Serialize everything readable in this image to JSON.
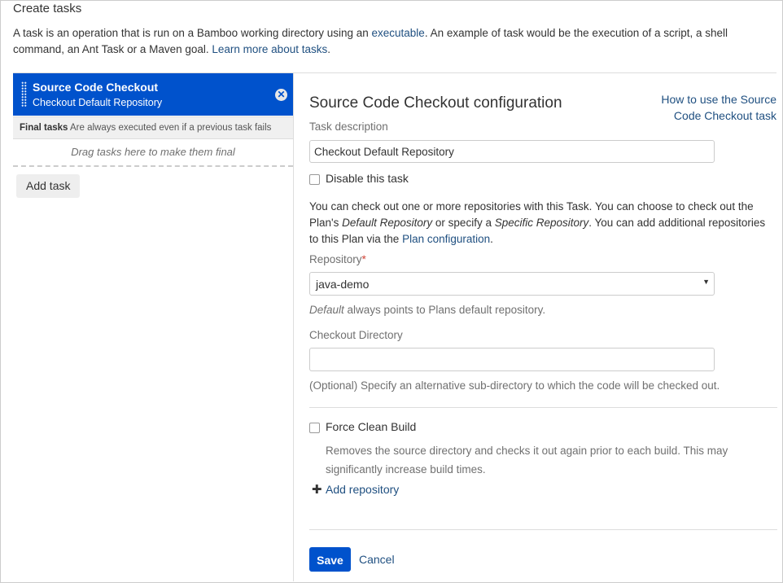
{
  "page": {
    "title": "Create tasks",
    "intro_part1": "A task is an operation that is run on a Bamboo working directory using an ",
    "intro_link1": "executable",
    "intro_part2": ". An example of task would be the execution of a script, a shell command, an Ant Task or a Maven goal. ",
    "intro_link2": "Learn more about tasks",
    "intro_part3": "."
  },
  "task_list": {
    "tasks": [
      {
        "name": "Source Code Checkout",
        "description": "Checkout Default Repository"
      }
    ],
    "final_tasks_label": "Final tasks",
    "final_tasks_text": "Are always executed even if a previous task fails",
    "drop_zone_text": "Drag tasks here to make them final",
    "add_task_label": "Add task",
    "remove_icon": "close-icon",
    "drag_icon": "drag-handle-icon"
  },
  "config": {
    "title": "Source Code Checkout configuration",
    "help_link": "How to use the Source Code Checkout task",
    "task_description_label": "Task description",
    "task_description_value": "Checkout Default Repository",
    "disable_task_label": "Disable this task",
    "disable_task_checked": false,
    "info_part1": "You can check out one or more repositories with this Task. You can choose to check out the Plan's ",
    "info_em1": "Default Repository",
    "info_part2": " or specify a ",
    "info_em2": "Specific Repository",
    "info_part3": ". You can add additional repositories to this Plan via the ",
    "info_link": "Plan configuration",
    "info_part4": ".",
    "repository_label": "Repository",
    "required_mark": "*",
    "repository_value": "java-demo",
    "repository_hint_em": "Default",
    "repository_hint": " always points to Plans default repository.",
    "checkout_dir_label": "Checkout Directory",
    "checkout_dir_value": "",
    "checkout_dir_hint": "(Optional) Specify an alternative sub-directory to which the code will be checked out.",
    "force_clean_label": "Force Clean Build",
    "force_clean_checked": false,
    "force_clean_hint": "Removes the source directory and checks it out again prior to each build. This may significantly increase build times.",
    "add_repository_label": "Add repository",
    "save_label": "Save",
    "cancel_label": "Cancel"
  },
  "colors": {
    "accent": "#0052cc",
    "link": "#205081"
  }
}
